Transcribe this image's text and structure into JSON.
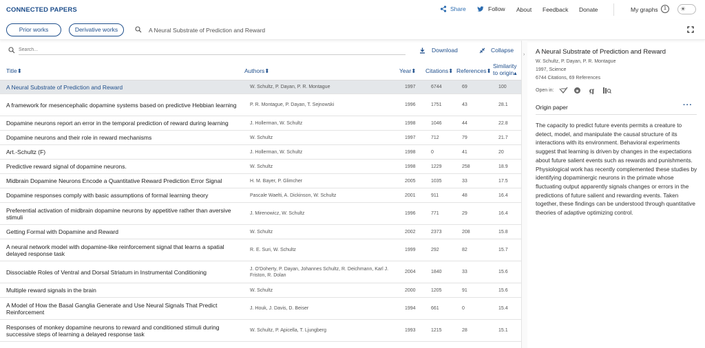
{
  "app": {
    "brand": "CONNECTED PAPERS"
  },
  "topnav": {
    "share": "Share",
    "follow": "Follow",
    "about": "About",
    "feedback": "Feedback",
    "donate": "Donate",
    "my_graphs": "My graphs",
    "my_graphs_count": "1"
  },
  "searchbar": {
    "prior_works": "Prior works",
    "derivative_works": "Derivative works",
    "query": "A Neural Substrate of Prediction and Reward"
  },
  "list": {
    "filter_placeholder": "Search...",
    "download": "Download",
    "collapse": "Collapse",
    "headers": {
      "title": "Title",
      "authors": "Authors",
      "year": "Year",
      "citations": "Citations",
      "references": "References",
      "similarity_line1": "Similarity",
      "similarity_line2": "to origin"
    },
    "rows": [
      {
        "title": "A Neural Substrate of Prediction and Reward",
        "authors": "W. Schultz, P. Dayan, P. R. Montague",
        "year": "1997",
        "citations": "6744",
        "references": "69",
        "similarity": "100"
      },
      {
        "title": "A framework for mesencephalic dopamine systems based on predictive Hebbian learning",
        "authors": "P. R. Montague, P. Dayan, T. Sejnowski",
        "year": "1996",
        "citations": "1751",
        "references": "43",
        "similarity": "28.1"
      },
      {
        "title": "Dopamine neurons report an error in the temporal prediction of reward during learning",
        "authors": "J. Hollerman, W. Schultz",
        "year": "1998",
        "citations": "1046",
        "references": "44",
        "similarity": "22.8"
      },
      {
        "title": "Dopamine neurons and their role in reward mechanisms",
        "authors": "W. Schultz",
        "year": "1997",
        "citations": "712",
        "references": "79",
        "similarity": "21.7"
      },
      {
        "title": "Art.-Schultz (F)",
        "authors": "J. Hollerman, W. Schultz",
        "year": "1998",
        "citations": "0",
        "references": "41",
        "similarity": "20"
      },
      {
        "title": "Predictive reward signal of dopamine neurons.",
        "authors": "W. Schultz",
        "year": "1998",
        "citations": "1229",
        "references": "258",
        "similarity": "18.9"
      },
      {
        "title": "Midbrain Dopamine Neurons Encode a Quantitative Reward Prediction Error Signal",
        "authors": "H. M. Bayer, P. Glimcher",
        "year": "2005",
        "citations": "1035",
        "references": "33",
        "similarity": "17.5"
      },
      {
        "title": "Dopamine responses comply with basic assumptions of formal learning theory",
        "authors": "Pascale Waelti, A. Dickinson, W. Schultz",
        "year": "2001",
        "citations": "911",
        "references": "48",
        "similarity": "16.4"
      },
      {
        "title": "Preferential activation of midbrain dopamine neurons by appetitive rather than aversive stimuli",
        "authors": "J. Mirenowicz, W. Schultz",
        "year": "1996",
        "citations": "771",
        "references": "29",
        "similarity": "16.4"
      },
      {
        "title": "Getting Formal with Dopamine and Reward",
        "authors": "W. Schultz",
        "year": "2002",
        "citations": "2373",
        "references": "208",
        "similarity": "15.8"
      },
      {
        "title": "A neural network model with dopamine-like reinforcement signal that learns a spatial delayed response task",
        "authors": "R. E. Suri, W. Schultz",
        "year": "1999",
        "citations": "292",
        "references": "82",
        "similarity": "15.7"
      },
      {
        "title": "Dissociable Roles of Ventral and Dorsal Striatum in Instrumental Conditioning",
        "authors": "J. O'Doherty, P. Dayan, Johannes Schultz, R. Deichmann, Karl J. Friston, R. Dolan",
        "year": "2004",
        "citations": "1840",
        "references": "33",
        "similarity": "15.6"
      },
      {
        "title": "Multiple reward signals in the brain",
        "authors": "W. Schultz",
        "year": "2000",
        "citations": "1205",
        "references": "91",
        "similarity": "15.6"
      },
      {
        "title": "A Model of How the Basal Ganglia Generate and Use Neural Signals That Predict Reinforcement",
        "authors": "J. Houk, J. Davis, D. Beiser",
        "year": "1994",
        "citations": "661",
        "references": "0",
        "similarity": "15.4"
      },
      {
        "title": "Responses of monkey dopamine neurons to reward and conditioned stimuli during successive steps of learning a delayed response task",
        "authors": "W. Schultz, P. Apicella, T. Ljungberg",
        "year": "1993",
        "citations": "1215",
        "references": "28",
        "similarity": "15.1"
      }
    ]
  },
  "detail": {
    "title": "A Neural Substrate of Prediction and Reward",
    "authors": "W. Schultz, P. Dayan, P. R. Montague",
    "year_venue": "1997, Science",
    "counts": "6744 Citations, 69 References",
    "open_in": "Open in:",
    "origin_label": "Origin paper",
    "abstract": "The capacity to predict future events permits a creature to detect, model, and manipulate the causal structure of its interactions with its environment. Behavioral experiments suggest that learning is driven by changes in the expectations about future salient events such as rewards and punishments. Physiological work has recently complemented these studies by identifying dopaminergic neurons in the primate whose fluctuating output apparently signals changes or errors in the predictions of future salient and rewarding events. Taken together, these findings can be understood through quantitative theories of adaptive optimizing control."
  },
  "colors": {
    "brand": "#1f4f8c",
    "selected_row": "#e4e7ea",
    "link": "#2b6cb0"
  }
}
